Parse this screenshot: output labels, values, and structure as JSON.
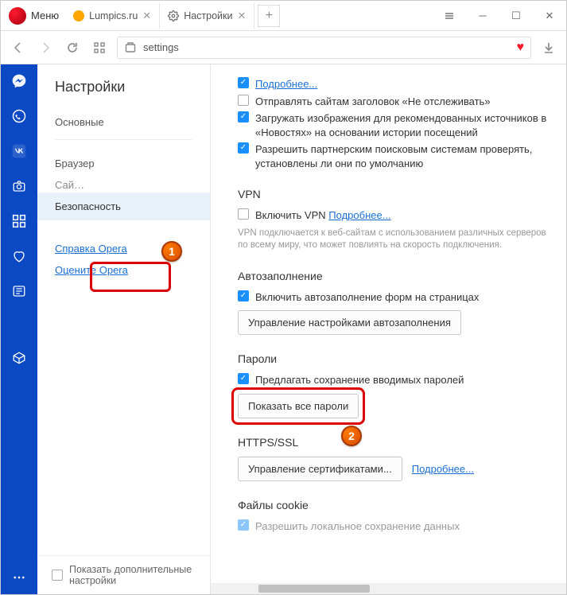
{
  "window": {
    "menu_label": "Меню",
    "tabs": [
      {
        "title": "Lumpics.ru"
      },
      {
        "title": "Настройки"
      }
    ],
    "addr": "settings"
  },
  "sidenav": {
    "title": "Настройки",
    "items": {
      "basic": "Основные",
      "browser": "Браузер",
      "sites_partial": "Сай…",
      "security": "Безопасность",
      "help": "Справка Opera",
      "rate": "Оцените Opera"
    },
    "show_advanced": "Показать дополнительные настройки"
  },
  "content": {
    "more": "Подробнее...",
    "dnt": "Отправлять сайтам заголовок «Не отслеживать»",
    "load_images": "Загружать изображения для рекомендованных источников в «Новостях» на основании истории посещений",
    "allow_partner": "Разрешить партнерским поисковым системам проверять, установлены ли они по умолчанию",
    "vpn_title": "VPN",
    "vpn_enable": "Включить VPN",
    "vpn_more": "Подробнее...",
    "vpn_hint": "VPN подключается к веб-сайтам с использованием различных серверов по всему миру, что может повлиять на скорость подключения.",
    "autofill_title": "Автозаполнение",
    "autofill_enable": "Включить автозаполнение форм на страницах",
    "autofill_manage": "Управление настройками автозаполнения",
    "passwords_title": "Пароли",
    "passwords_offer": "Предлагать сохранение вводимых паролей",
    "passwords_show_all": "Показать все пароли",
    "https_title": "HTTPS/SSL",
    "https_manage": "Управление сертификатами...",
    "https_more": "Подробнее...",
    "cookies_title": "Файлы cookie",
    "cookies_partial": "Разрешить локальное сохранение данных"
  },
  "badges": {
    "b1": "1",
    "b2": "2"
  }
}
